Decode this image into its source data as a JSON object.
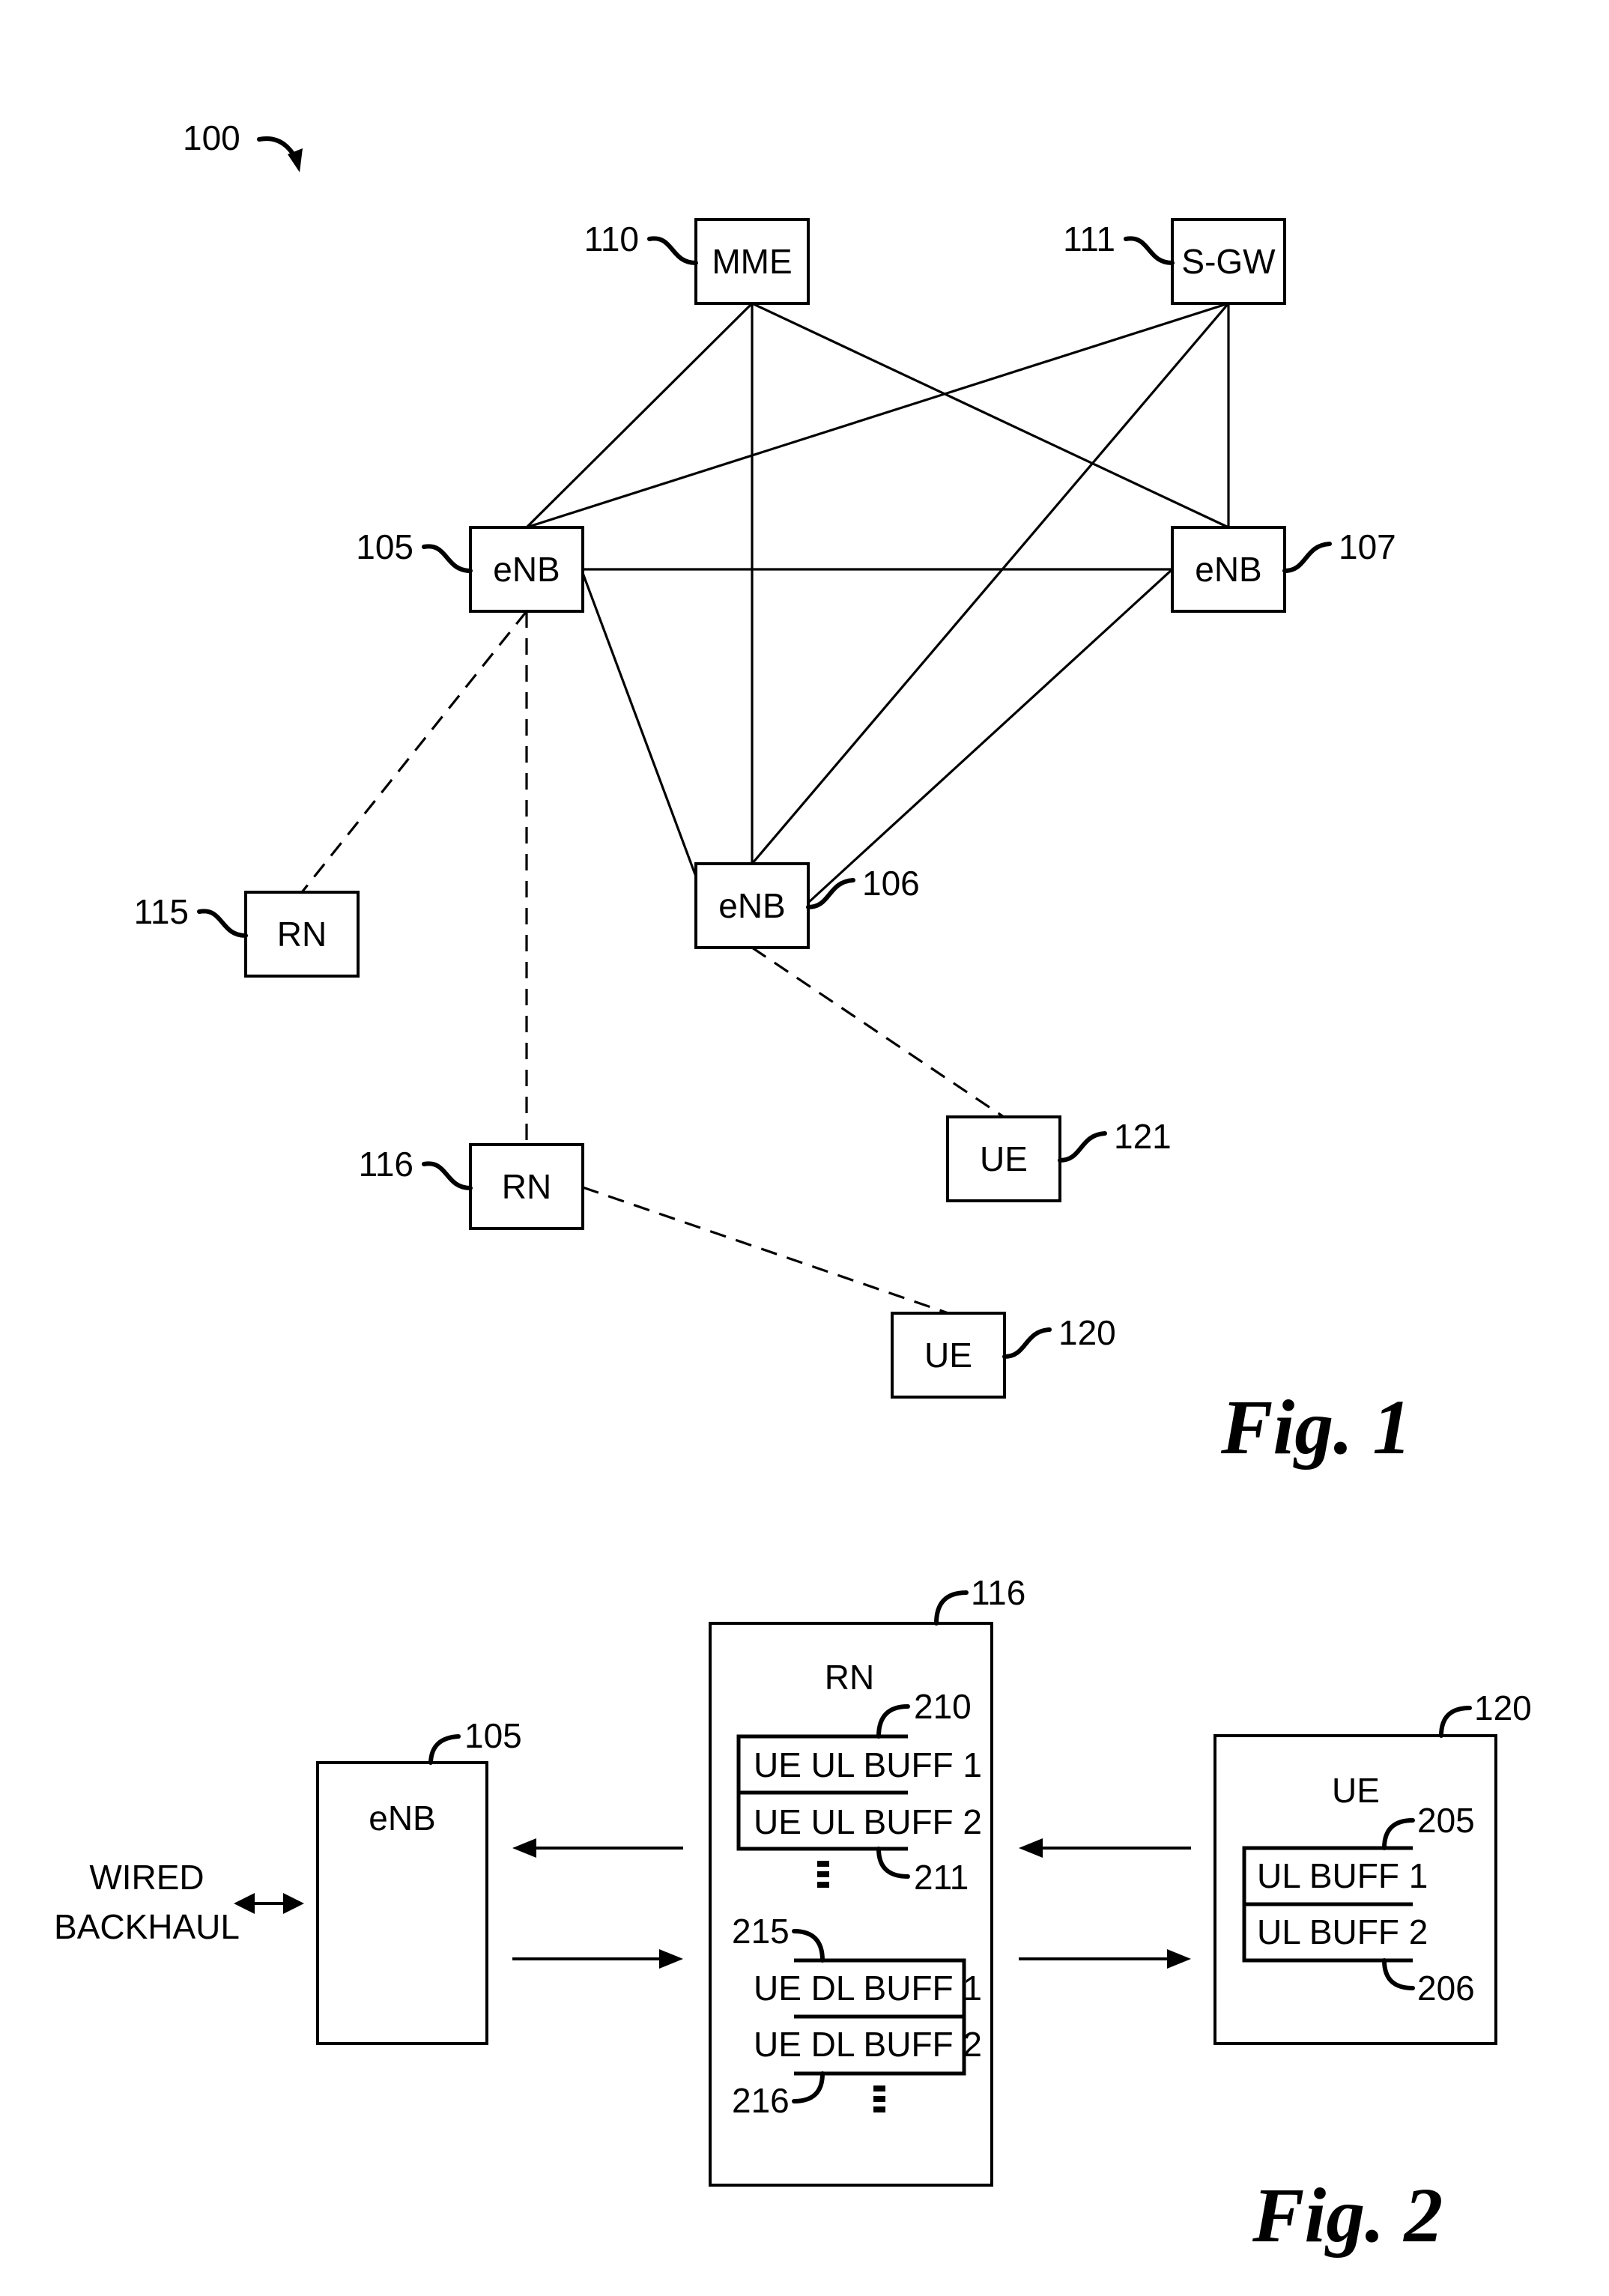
{
  "figure1": {
    "ref_label": "100",
    "fig_label": "Fig. 1",
    "nodes": [
      {
        "id": "mme",
        "label": "MME",
        "ref": "110"
      },
      {
        "id": "sgw",
        "label": "S-GW",
        "ref": "111"
      },
      {
        "id": "enb105",
        "label": "eNB",
        "ref": "105"
      },
      {
        "id": "enb107",
        "label": "eNB",
        "ref": "107"
      },
      {
        "id": "enb106",
        "label": "eNB",
        "ref": "106"
      },
      {
        "id": "rn115",
        "label": "RN",
        "ref": "115"
      },
      {
        "id": "rn116",
        "label": "RN",
        "ref": "116"
      },
      {
        "id": "ue121",
        "label": "UE",
        "ref": "121"
      },
      {
        "id": "ue120",
        "label": "UE",
        "ref": "120"
      }
    ],
    "wired_links": [
      [
        "mme",
        "enb105"
      ],
      [
        "mme",
        "enb106"
      ],
      [
        "mme",
        "enb107"
      ],
      [
        "sgw",
        "enb105"
      ],
      [
        "sgw",
        "enb106"
      ],
      [
        "sgw",
        "enb107"
      ],
      [
        "enb105",
        "enb107"
      ],
      [
        "enb105",
        "enb106"
      ],
      [
        "enb107",
        "enb106"
      ]
    ],
    "wireless_links": [
      [
        "enb105",
        "rn115"
      ],
      [
        "enb105",
        "rn116"
      ],
      [
        "enb106",
        "ue121"
      ],
      [
        "rn116",
        "ue120"
      ]
    ]
  },
  "figure2": {
    "fig_label": "Fig. 2",
    "backhaul_label_line1": "WIRED",
    "backhaul_label_line2": "BACKHAUL",
    "enb": {
      "label": "eNB",
      "ref": "105"
    },
    "rn": {
      "label": "RN",
      "ref": "116",
      "ul_buffers": [
        "UE UL BUFF 1",
        "UE UL BUFF 2"
      ],
      "ul_refs": [
        "210",
        "211"
      ],
      "dl_buffers": [
        "UE DL BUFF 1",
        "UE DL BUFF 2"
      ],
      "dl_refs": [
        "215",
        "216"
      ]
    },
    "ue": {
      "label": "UE",
      "ref": "120",
      "buffers": [
        "UL BUFF 1",
        "UL BUFF 2"
      ],
      "refs": [
        "205",
        "206"
      ]
    }
  }
}
